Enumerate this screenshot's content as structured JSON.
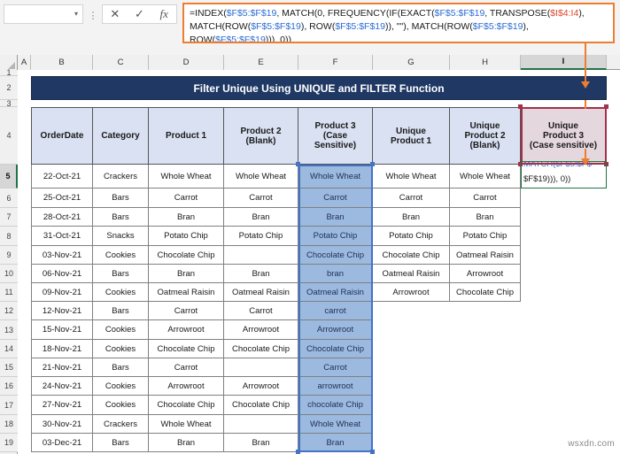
{
  "formula_bar": {
    "name_box_value": "",
    "name_box_caret": "▾",
    "kebab": "⋮",
    "cancel_label": "✕",
    "enter_label": "✓",
    "fx_label": "fx",
    "formula_segments": [
      {
        "t": "=INDEX(",
        "c": "k"
      },
      {
        "t": "$F$5:$F$19",
        "c": "b"
      },
      {
        "t": ", MATCH(0, FREQUENCY(IF(EXACT(",
        "c": "k"
      },
      {
        "t": "$F$5:$F$19",
        "c": "b"
      },
      {
        "t": ", TRANSPOSE(",
        "c": "k"
      },
      {
        "t": "$I$4:I4",
        "c": "r"
      },
      {
        "t": "), MATCH(",
        "c": "k"
      },
      {
        "t": "ROW(",
        "c": "k"
      },
      {
        "t": "$F$5:$F$19",
        "c": "b"
      },
      {
        "t": "), ROW(",
        "c": "k"
      },
      {
        "t": "$F$5:$F$19",
        "c": "b"
      },
      {
        "t": ")), \"\"), MATCH(ROW(",
        "c": "k"
      },
      {
        "t": "$F$5:$F$19",
        "c": "b"
      },
      {
        "t": "), ROW(",
        "c": "k"
      },
      {
        "t": "$F$5:$F$19",
        "c": "b"
      },
      {
        "t": "))), 0))",
        "c": "k"
      }
    ],
    "formula_plain": "=INDEX($F$5:$F$19, MATCH(0, FREQUENCY(IF(EXACT($F$5:$F$19, TRANSPOSE($I$4:I4)), MATCH(ROW($F$5:$F$19), ROW($F$5:$F$19)), \"\"), MATCH(ROW($F$5:$F$19), ROW($F$5:$F$19))), 0))"
  },
  "sheet": {
    "column_letters": [
      "A",
      "B",
      "C",
      "D",
      "E",
      "F",
      "G",
      "H",
      "I"
    ],
    "selected_column": "I",
    "row_numbers": [
      "1",
      "2",
      "3",
      "4",
      "5",
      "6",
      "7",
      "8",
      "9",
      "10",
      "11",
      "12",
      "13",
      "14",
      "15",
      "16",
      "17",
      "18",
      "19"
    ],
    "selected_row": "5",
    "banner_title": "Filter Unique Using UNIQUE and FILTER Function",
    "headers": [
      {
        "lines": [
          "OrderDate"
        ]
      },
      {
        "lines": [
          "Category"
        ]
      },
      {
        "lines": [
          "Product 1"
        ]
      },
      {
        "lines": [
          "Product 2",
          "(Blank)"
        ]
      },
      {
        "lines": [
          "Product 3",
          "(Case",
          "Sensitive)"
        ]
      },
      {
        "lines": [
          "Unique",
          "Product 1"
        ]
      },
      {
        "lines": [
          "Unique",
          "Product 2",
          "(Blank)"
        ]
      },
      {
        "lines": [
          "Unique",
          "Product 3",
          "(Case sensitive)"
        ]
      }
    ],
    "rows": [
      {
        "row": "5",
        "order_date": "22-Oct-21",
        "category": "Crackers",
        "product1": "Whole Wheat",
        "product2": "Whole Wheat",
        "product3": "Whole Wheat",
        "unique1": "Whole Wheat",
        "unique2": "Whole Wheat"
      },
      {
        "row": "6",
        "order_date": "25-Oct-21",
        "category": "Bars",
        "product1": "Carrot",
        "product2": "Carrot",
        "product3": "Carrot",
        "unique1": "Carrot",
        "unique2": "Carrot"
      },
      {
        "row": "7",
        "order_date": "28-Oct-21",
        "category": "Bars",
        "product1": "Bran",
        "product2": "Bran",
        "product3": "Bran",
        "unique1": "Bran",
        "unique2": "Bran"
      },
      {
        "row": "8",
        "order_date": "31-Oct-21",
        "category": "Snacks",
        "product1": "Potato Chip",
        "product2": "Potato Chip",
        "product3": "Potato Chip",
        "unique1": "Potato Chip",
        "unique2": "Potato Chip"
      },
      {
        "row": "9",
        "order_date": "03-Nov-21",
        "category": "Cookies",
        "product1": "Chocolate Chip",
        "product2": "",
        "product3": "Chocolate Chip",
        "unique1": "Chocolate Chip",
        "unique2": "Oatmeal Raisin"
      },
      {
        "row": "10",
        "order_date": "06-Nov-21",
        "category": "Bars",
        "product1": "Bran",
        "product2": "Bran",
        "product3": "bran",
        "unique1": "Oatmeal Raisin",
        "unique2": "Arrowroot"
      },
      {
        "row": "11",
        "order_date": "09-Nov-21",
        "category": "Cookies",
        "product1": "Oatmeal Raisin",
        "product2": "Oatmeal Raisin",
        "product3": "Oatmeal Raisin",
        "unique1": "Arrowroot",
        "unique2": "Chocolate Chip"
      },
      {
        "row": "12",
        "order_date": "12-Nov-21",
        "category": "Bars",
        "product1": "Carrot",
        "product2": "Carrot",
        "product3": "carrot",
        "unique1": "",
        "unique2": ""
      },
      {
        "row": "13",
        "order_date": "15-Nov-21",
        "category": "Cookies",
        "product1": "Arrowroot",
        "product2": "Arrowroot",
        "product3": "Arrowroot",
        "unique1": "",
        "unique2": ""
      },
      {
        "row": "14",
        "order_date": "18-Nov-21",
        "category": "Cookies",
        "product1": "Chocolate Chip",
        "product2": "Chocolate Chip",
        "product3": "Chocolate Chip",
        "unique1": "",
        "unique2": ""
      },
      {
        "row": "15",
        "order_date": "21-Nov-21",
        "category": "Bars",
        "product1": "Carrot",
        "product2": "",
        "product3": "Carrot",
        "unique1": "",
        "unique2": ""
      },
      {
        "row": "16",
        "order_date": "24-Nov-21",
        "category": "Cookies",
        "product1": "Arrowroot",
        "product2": "Arrowroot",
        "product3": "arrowroot",
        "unique1": "",
        "unique2": ""
      },
      {
        "row": "17",
        "order_date": "27-Nov-21",
        "category": "Cookies",
        "product1": "Chocolate Chip",
        "product2": "Chocolate Chip",
        "product3": "chocolate Chip",
        "unique1": "",
        "unique2": ""
      },
      {
        "row": "18",
        "order_date": "30-Nov-21",
        "category": "Crackers",
        "product1": "Whole Wheat",
        "product2": "",
        "product3": "Whole Wheat",
        "unique1": "",
        "unique2": ""
      },
      {
        "row": "19",
        "order_date": "03-Dec-21",
        "category": "Bars",
        "product1": "Bran",
        "product2": "Bran",
        "product3": "Bran",
        "unique1": "",
        "unique2": ""
      }
    ],
    "editing_cell": {
      "address": "I5",
      "visible_tail": "$F$19))), 0))",
      "clipped_top": "MATCH($F$5:$F$"
    }
  },
  "watermark": "wsxdn.com",
  "colors": {
    "banner_bg": "#1F3864",
    "header_bg": "#D9E1F2",
    "selection_blue": "#4472C4",
    "selected_fill": "#9CB9E0",
    "annotation_orange": "#ED7D31",
    "reference_red": "#A5304A",
    "excel_green": "#217346"
  }
}
